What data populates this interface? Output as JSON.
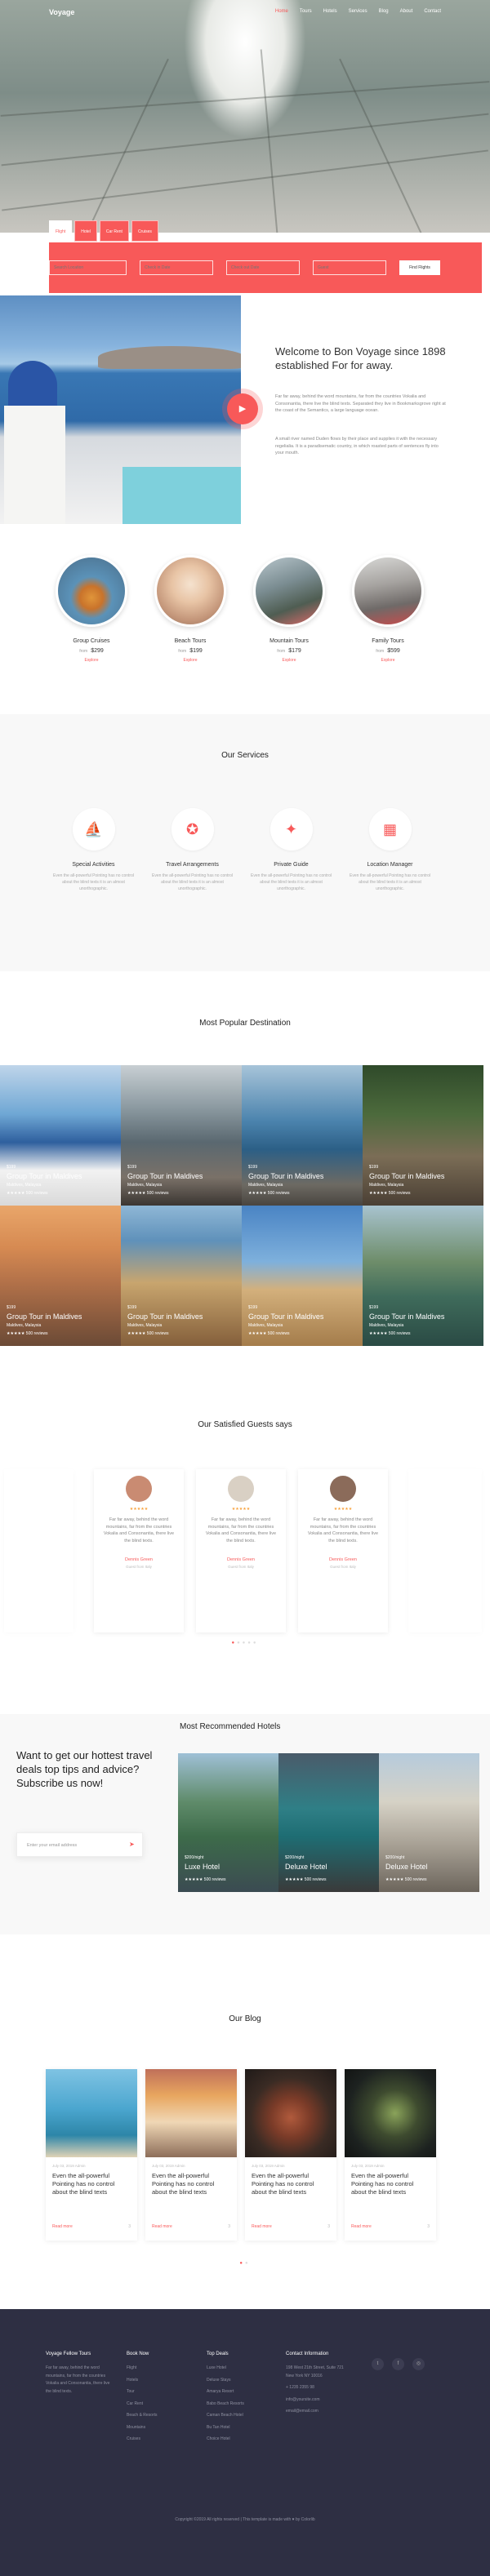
{
  "nav": {
    "brand": "Voyage",
    "items": [
      "Home",
      "Tours",
      "Hotels",
      "Services",
      "Blog",
      "About",
      "Contact"
    ]
  },
  "search": {
    "tabs": [
      "Flight",
      "Hotel",
      "Car Rent",
      "Cruises"
    ],
    "fields": [
      "Search Location",
      "Check in Date",
      "Check out Date",
      "Guest"
    ],
    "button": "Find Flights"
  },
  "about": {
    "heading": "Welcome to Bon Voyage since 1898 established For for away.",
    "p1": "Far far away, behind the word mountains, far from the countries Vokalia and Consonantia, there live the blind texts. Separated they live in Bookmarksgrove right at the coast of the Semantics, a large language ocean.",
    "p2": "A small river named Duden flows by their place and supplies it with the necessary regelialia. It is a paradisematic country, in which roasted parts of sentences fly into your mouth."
  },
  "categories": [
    {
      "name": "Group Cruises",
      "from": "from",
      "price": "$299",
      "more": "Explore"
    },
    {
      "name": "Beach Tours",
      "from": "from",
      "price": "$199",
      "more": "Explore"
    },
    {
      "name": "Mountain Tours",
      "from": "from",
      "price": "$179",
      "more": "Explore"
    },
    {
      "name": "Family Tours",
      "from": "from",
      "price": "$599",
      "more": "Explore"
    }
  ],
  "services": {
    "title": "Our Services",
    "items": [
      {
        "title": "Special Activities",
        "desc": "Even the all-powerful Pointing has no control about the blind texts it is an almost unorthographic."
      },
      {
        "title": "Travel Arrangements",
        "desc": "Even the all-powerful Pointing has no control about the blind texts it is an almost unorthographic."
      },
      {
        "title": "Private Guide",
        "desc": "Even the all-powerful Pointing has no control about the blind texts it is an almost unorthographic."
      },
      {
        "title": "Location Manager",
        "desc": "Even the all-powerful Pointing has no control about the blind texts it is an almost unorthographic."
      }
    ]
  },
  "destinations": {
    "title": "Most Popular Destination",
    "items": [
      {
        "price": "$199",
        "title": "Group Tour in Maldives",
        "loc": "Maldives, Malaysia",
        "rate": "★★★★★ 500 reviews"
      },
      {
        "price": "$199",
        "title": "Group Tour in Maldives",
        "loc": "Maldives, Malaysia",
        "rate": "★★★★★ 500 reviews"
      },
      {
        "price": "$199",
        "title": "Group Tour in Maldives",
        "loc": "Maldives, Malaysia",
        "rate": "★★★★★ 500 reviews"
      },
      {
        "price": "$199",
        "title": "Group Tour in Maldives",
        "loc": "Maldives, Malaysia",
        "rate": "★★★★★ 500 reviews"
      },
      {
        "price": "$199",
        "title": "Group Tour in Maldives",
        "loc": "Maldives, Malaysia",
        "rate": "★★★★★ 500 reviews"
      },
      {
        "price": "$199",
        "title": "Group Tour in Maldives",
        "loc": "Maldives, Malaysia",
        "rate": "★★★★★ 500 reviews"
      },
      {
        "price": "$199",
        "title": "Group Tour in Maldives",
        "loc": "Maldives, Malaysia",
        "rate": "★★★★★ 500 reviews"
      },
      {
        "price": "$199",
        "title": "Group Tour in Maldives",
        "loc": "Maldives, Malaysia",
        "rate": "★★★★★ 500 reviews"
      }
    ]
  },
  "testimonials": {
    "title": "Our Satisfied Guests says",
    "items": [
      {
        "stars": "★★★★★",
        "quote": "Far far away, behind the word mountains, far from the countries Vokalia and Consonantia, there live the blind texts.",
        "name": "Dennis Green",
        "role": "Guest from Italy"
      },
      {
        "stars": "★★★★★",
        "quote": "Far far away, behind the word mountains, far from the countries Vokalia and Consonantia, there live the blind texts.",
        "name": "Dennis Green",
        "role": "Guest from Italy"
      },
      {
        "stars": "★★★★★",
        "quote": "Far far away, behind the word mountains, far from the countries Vokalia and Consonantia, there live the blind texts.",
        "name": "Dennis Green",
        "role": "Guest from Italy"
      }
    ]
  },
  "hotels": {
    "subscribe_q": "Want to get our hottest travel deals top tips and advice? Subscribe us now!",
    "email_placeholder": "Enter your email address",
    "title": "Most Recommended Hotels",
    "items": [
      {
        "price": "$200/night",
        "title": "Luxe Hotel",
        "rate": "★★★★★ 500 reviews"
      },
      {
        "price": "$200/night",
        "title": "Deluxe Hotel",
        "rate": "★★★★★ 500 reviews"
      },
      {
        "price": "$200/night",
        "title": "Deluxe Hotel",
        "rate": "★★★★★ 500 reviews"
      }
    ]
  },
  "blog": {
    "title": "Our Blog",
    "items": [
      {
        "meta": "July 03, 2019   Admin",
        "title": "Even the all-powerful Pointing has no control about the blind texts",
        "more": "Read more",
        "comments": "3"
      },
      {
        "meta": "July 03, 2019   Admin",
        "title": "Even the all-powerful Pointing has no control about the blind texts",
        "more": "Read more",
        "comments": "3"
      },
      {
        "meta": "July 03, 2019   Admin",
        "title": "Even the all-powerful Pointing has no control about the blind texts",
        "more": "Read more",
        "comments": "3"
      },
      {
        "meta": "July 03, 2019   Admin",
        "title": "Even the all-powerful Pointing has no control about the blind texts",
        "more": "Read more",
        "comments": "3"
      }
    ]
  },
  "footer": {
    "about_title": "Voyage Fellow Tours",
    "about_text": "Far far away, behind the word mountains, far from the countries Vokalia and Consonantia, there live the blind texts.",
    "book_title": "Book Now",
    "book_items": [
      "Flight",
      "Hotels",
      "Tour",
      "Car Rent",
      "Beach & Resorts",
      "Mountains",
      "Cruises"
    ],
    "deals_title": "Top Deals",
    "deals_items": [
      "Luxe Hotel",
      "Deluxe Stays",
      "Amarya Resort",
      "Babo Beach Resorts",
      "Caman Beach Hotel",
      "Bu Tan Hotel",
      "Choice Hotel"
    ],
    "contact_title": "Contact Information",
    "contact_items": [
      "198 West 21th Street, Suite 721 New York NY 10016",
      "+ 1235 2355 98",
      "info@yoursite.com",
      "email@email.com"
    ],
    "copyright": "Copyright ©2019 All rights reserved | This template is made with ♥ by Colorlib"
  },
  "colors": {
    "accent": "#f85959",
    "footer_bg": "#2e2f43"
  }
}
